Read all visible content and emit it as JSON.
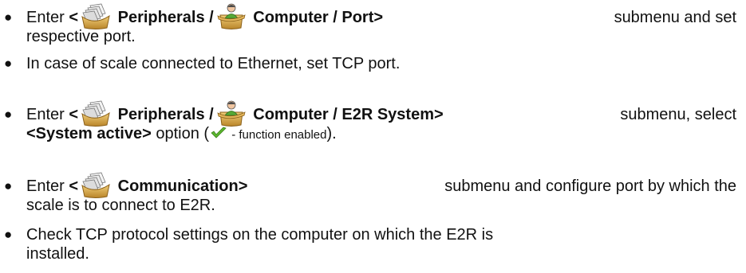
{
  "bullets": [
    {
      "enter": "Enter",
      "lt": "<",
      "path1": "Peripherals /",
      "path2": "Computer / Port>",
      "rest1": "submenu and set",
      "rest2": "respective port."
    },
    {
      "text": "In case of scale connected to Ethernet, set TCP port."
    },
    {
      "enter": "Enter",
      "lt": "<",
      "path1": "Peripherals /",
      "path2": "Computer / E2R System>",
      "rest1": "submenu, select",
      "option": "<System active>",
      "option_word": "option (",
      "note": " - function enabled",
      "close": ")."
    },
    {
      "enter": "Enter",
      "lt": "<",
      "path1": "Communication>",
      "rest1": "submenu and configure port by which the",
      "rest2": "scale is to connect to E2R."
    },
    {
      "line1": "Check TCP protocol settings on the computer on which the E2R is",
      "line2": "installed."
    }
  ],
  "icons": {
    "folder": "folder-icon",
    "computer": "computer-folder-icon",
    "check": "check-icon"
  },
  "colors": {
    "check": "#5cb82e",
    "folder": "#d8a640"
  }
}
